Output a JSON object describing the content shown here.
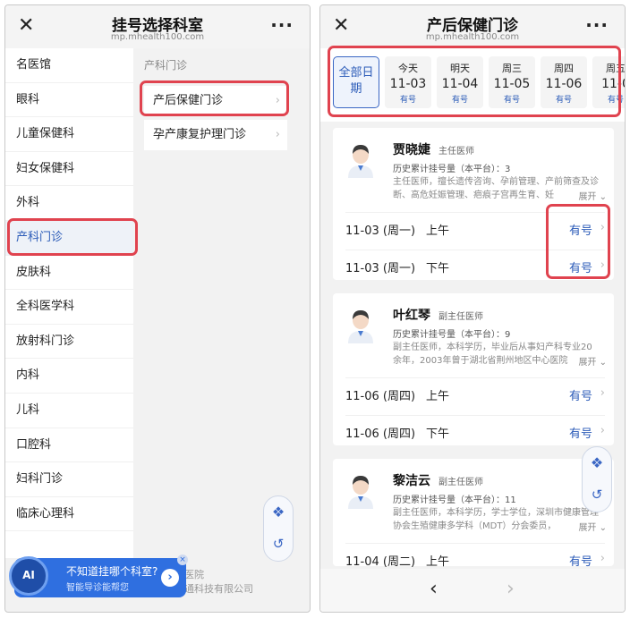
{
  "left": {
    "header": {
      "close": "✕",
      "title": "挂号选择科室",
      "domain": "mp.mhealth100.com",
      "more": "···"
    },
    "sidebar": {
      "items": [
        "名医馆",
        "眼科",
        "儿童保健科",
        "妇女保健科",
        "外科",
        "产科门诊",
        "皮肤科",
        "全科医学科",
        "放射科门诊",
        "内科",
        "儿科",
        "口腔科",
        "妇科门诊",
        "临床心理科"
      ],
      "active_index": 5
    },
    "content": {
      "group_title": "产科门诊",
      "subs": [
        "产后保健门诊",
        "孕产康复护理门诊"
      ]
    },
    "footer": {
      "line1": "医院",
      "line2": "通科技有限公司"
    },
    "ai_banner": {
      "avatar": "AI",
      "line1": "不知道挂哪个科室?",
      "line2": "智能导诊能帮您",
      "go": "›",
      "close": "×"
    },
    "float_buttons": {
      "apps": "❖",
      "back": "↺"
    }
  },
  "right": {
    "header": {
      "close": "✕",
      "title": "产后保健门诊",
      "domain": "mp.mhealth100.com",
      "more": "···"
    },
    "dates": {
      "all": "全部日期",
      "days": [
        {
          "week": "今天",
          "date": "11-03",
          "status": "有号"
        },
        {
          "week": "明天",
          "date": "11-04",
          "status": "有号"
        },
        {
          "week": "周三",
          "date": "11-05",
          "status": "有号"
        },
        {
          "week": "周四",
          "date": "11-06",
          "status": "有号"
        },
        {
          "week": "周五",
          "date": "11-0",
          "status": "有号"
        }
      ]
    },
    "doctors": [
      {
        "name": "贾晓婕",
        "title": "主任医师",
        "count": "历史累计挂号量（本平台）：3",
        "bio": "主任医师，擅长遗传咨询、孕前管理、产前筛查及诊断、高危妊娠管理、疤痕子宫再生育、妊",
        "expand": "展开",
        "slots": [
          {
            "date": "11-03 (周一)",
            "period": "上午",
            "status": "有号"
          },
          {
            "date": "11-03 (周一)",
            "period": "下午",
            "status": "有号"
          }
        ]
      },
      {
        "name": "叶红琴",
        "title": "副主任医师",
        "count": "历史累计挂号量（本平台）：9",
        "bio": "副主任医师，本科学历，毕业后从事妇产科专业20余年，2003年曾于湖北省荆州地区中心医院",
        "expand": "展开",
        "slots": [
          {
            "date": "11-06 (周四)",
            "period": "上午",
            "status": "有号"
          },
          {
            "date": "11-06 (周四)",
            "period": "下午",
            "status": "有号"
          }
        ]
      },
      {
        "name": "黎洁云",
        "title": "副主任医师",
        "count": "历史累计挂号量（本平台）：11",
        "bio": "副主任医师，本科学历，学士学位，深圳市健康管理协会生殖健康多学科（MDT）分会委员，",
        "expand": "展开",
        "slots": [
          {
            "date": "11-04 (周二)",
            "period": "上午",
            "status": "有号"
          }
        ]
      }
    ],
    "nav": {
      "back": "‹",
      "forward": "›"
    },
    "float_buttons": {
      "apps": "❖",
      "back": "↺"
    }
  },
  "colors": {
    "accent": "#2b5bb8",
    "highlight": "#e0434f"
  }
}
